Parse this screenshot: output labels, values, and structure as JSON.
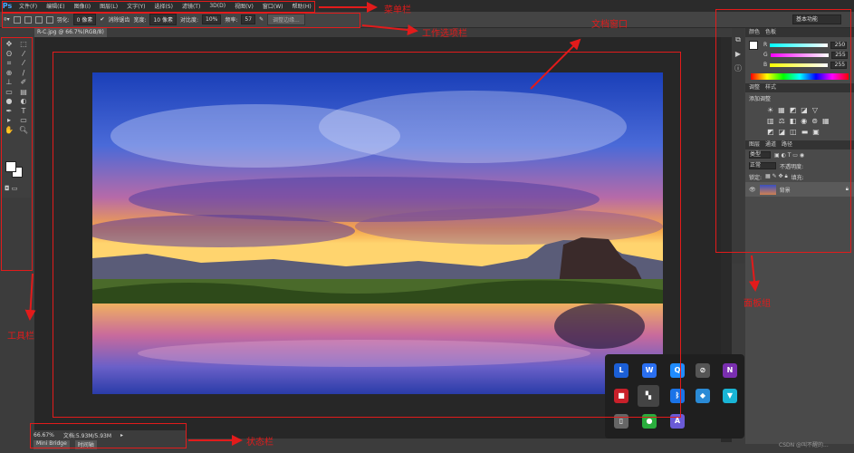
{
  "app": {
    "logo": "Ps"
  },
  "menubar": {
    "items": [
      "文件(F)",
      "编辑(E)",
      "图像(I)",
      "图层(L)",
      "文字(Y)",
      "选择(S)",
      "滤镜(T)",
      "3D(D)",
      "视图(V)",
      "窗口(W)",
      "帮助(H)"
    ]
  },
  "options": {
    "feather_label": "羽化:",
    "feather_value": "0 像素",
    "antialias_label": "消除锯齿",
    "width_label": "宽度:",
    "width_value": "10 像素",
    "contrast_label": "对比度:",
    "contrast_value": "10%",
    "frequency_label": "频率:",
    "frequency_value": "57",
    "refine_edge": "调整边缘..."
  },
  "workspace": {
    "label": "基本功能"
  },
  "document": {
    "tab": "R-C.jpg @ 66.7%(RGB/8)"
  },
  "status": {
    "zoom": "66.67%",
    "doc_size": "文档:5.93M/5.93M"
  },
  "bottom_tabs": [
    "Mini Bridge",
    "时间轴"
  ],
  "panels": {
    "color_tabs": [
      "颜色",
      "色板"
    ],
    "r_label": "R",
    "r_value": "250",
    "g_label": "G",
    "g_value": "255",
    "b_label": "B",
    "b_value": "255",
    "adjust_tabs": [
      "调整",
      "样式"
    ],
    "add_adjustment": "添加调整",
    "layer_tabs": [
      "图层",
      "通道",
      "路径"
    ],
    "kind_label": "类型",
    "blend_mode": "正常",
    "opacity_label": "不透明度:",
    "lock_label": "锁定:",
    "fill_label": "填充:",
    "layer_name": "背景"
  },
  "annotations": {
    "menubar": "菜单栏",
    "options": "工作选项栏",
    "document_window": "文档窗口",
    "toolbar": "工具栏",
    "panels": "面板组",
    "statusbar": "状态栏"
  },
  "tray": {
    "icons": [
      {
        "name": "lenovo-icon",
        "glyph": "L",
        "color": "#1b5fd6"
      },
      {
        "name": "wps-icon",
        "glyph": "W",
        "color": "#2a6ff0"
      },
      {
        "name": "qq-icon",
        "glyph": "Q",
        "color": "#1f8cff"
      },
      {
        "name": "network-off-icon",
        "glyph": "⊘",
        "color": "#555"
      },
      {
        "name": "onenote-icon",
        "glyph": "N",
        "color": "#7a2fb0"
      },
      {
        "name": "app-red-icon",
        "glyph": "■",
        "color": "#c8202a"
      },
      {
        "name": "notion-like-icon",
        "glyph": "▚",
        "color": "#444"
      },
      {
        "name": "bluetooth-icon",
        "glyph": "ᛒ",
        "color": "#1a73e8"
      },
      {
        "name": "shield-icon",
        "glyph": "◆",
        "color": "#2a8ad6"
      },
      {
        "name": "vpn-icon",
        "glyph": "▼",
        "color": "#19b5d6"
      },
      {
        "name": "usb-icon",
        "glyph": "▯",
        "color": "#666"
      },
      {
        "name": "wechat-icon",
        "glyph": "●",
        "color": "#2aae3d"
      },
      {
        "name": "arrow-app-icon",
        "glyph": "A",
        "color": "#6a5ad6"
      }
    ]
  },
  "watermark": "CSDN @叫不醒的..."
}
